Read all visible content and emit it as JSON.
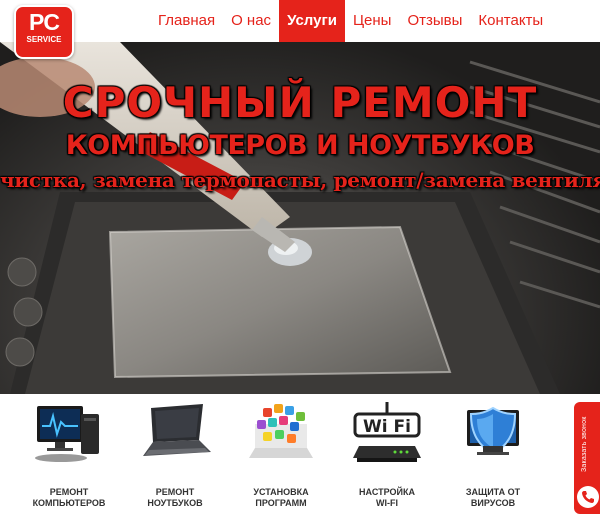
{
  "logo": {
    "line1": "PC",
    "line2": "SERVICE"
  },
  "nav": {
    "items": [
      {
        "label": "Главная",
        "active": false
      },
      {
        "label": "О нас",
        "active": false
      },
      {
        "label": "Услуги",
        "active": true
      },
      {
        "label": "Цены",
        "active": false
      },
      {
        "label": "Отзывы",
        "active": false
      },
      {
        "label": "Контакты",
        "active": false
      }
    ]
  },
  "hero": {
    "title": "СРОЧНЫЙ РЕМОНТ",
    "subtitle": "КОМПЬЮТЕРОВ И НОУТБУКОВ",
    "tagline": "чистка, замена  термопасты, ремонт/замена вентиляторов",
    "image": "cpu-thermal-paste-photo"
  },
  "services": [
    {
      "line1": "РЕМОНТ",
      "line2": "КОМПЬЮТЕРОВ",
      "icon": "computer-icon"
    },
    {
      "line1": "РЕМОНТ",
      "line2": "НОУТБУКОВ",
      "icon": "laptop-icon"
    },
    {
      "line1": "УСТАНОВКА",
      "line2": "ПРОГРАММ",
      "icon": "apps-laptop-icon"
    },
    {
      "line1": "НАСТРОЙКА",
      "line2": "WI-FI",
      "icon": "wifi-router-icon"
    },
    {
      "line1": "ЗАЩИТА ОТ",
      "line2": "ВИРУСОВ",
      "icon": "antivirus-icon"
    }
  ],
  "wifi_sign": "Wi Fi",
  "callback": {
    "label": "Заказать звонок",
    "icon": "phone-icon"
  },
  "colors": {
    "accent": "#e5231b",
    "text": "#333333",
    "background": "#ffffff"
  }
}
